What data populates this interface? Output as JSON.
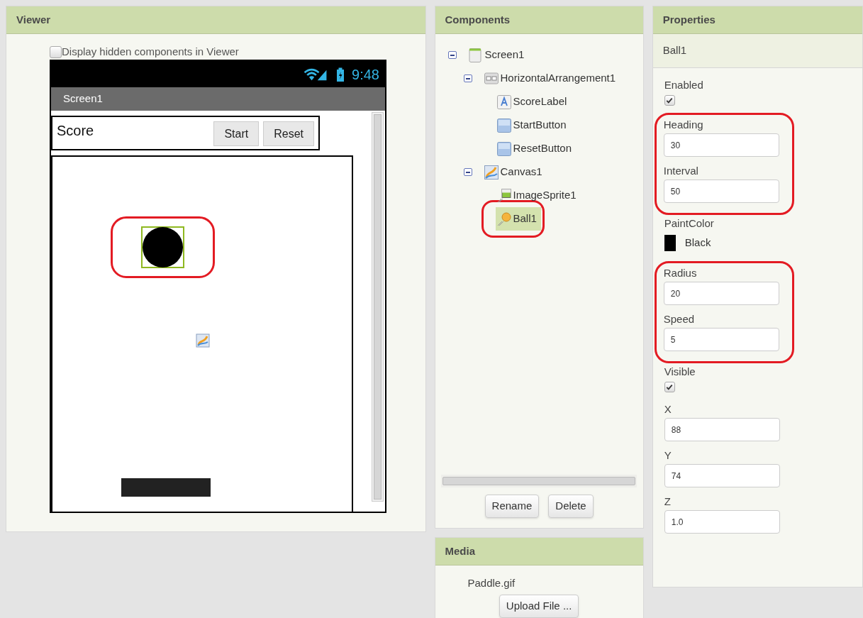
{
  "viewer": {
    "title": "Viewer",
    "display_hidden": {
      "label": "Display hidden components in Viewer",
      "checked": false
    },
    "phone": {
      "time": "9:48",
      "screen_title": "Screen1",
      "score_label": "Score",
      "buttons": [
        "Start",
        "Reset"
      ],
      "sprites": [
        {
          "kind": "ball",
          "selected": true,
          "highlighted": true
        },
        {
          "kind": "paddle",
          "selected": false
        }
      ]
    }
  },
  "components": {
    "title": "Components",
    "tree": [
      {
        "label": "Screen1",
        "kind": "screen",
        "expanded": true,
        "selected": false,
        "children": [
          {
            "label": "HorizontalArrangement1",
            "kind": "arrangement",
            "expanded": true,
            "selected": false,
            "children": [
              {
                "label": "ScoreLabel",
                "kind": "label",
                "selected": false
              },
              {
                "label": "StartButton",
                "kind": "button",
                "selected": false
              },
              {
                "label": "ResetButton",
                "kind": "button",
                "selected": false
              }
            ]
          },
          {
            "label": "Canvas1",
            "kind": "canvas",
            "expanded": true,
            "selected": false,
            "children": [
              {
                "label": "ImageSprite1",
                "kind": "sprite",
                "selected": false
              },
              {
                "label": "Ball1",
                "kind": "ball",
                "selected": true,
                "highlighted": true
              }
            ]
          }
        ]
      }
    ],
    "buttons": [
      "Rename",
      "Delete"
    ]
  },
  "media": {
    "title": "Media",
    "files": [
      "Paddle.gif"
    ],
    "upload_button": "Upload File ..."
  },
  "properties": {
    "title": "Properties",
    "component": "Ball1",
    "items": [
      {
        "kind": "checkbox",
        "label": "Enabled",
        "checked": true
      },
      {
        "kind": "number",
        "label": "Heading",
        "value": "30",
        "highlighted": true
      },
      {
        "kind": "number",
        "label": "Interval",
        "value": "50",
        "highlighted": true
      },
      {
        "kind": "color",
        "label": "PaintColor",
        "value": "Black",
        "color": "#000000"
      },
      {
        "kind": "number",
        "label": "Radius",
        "value": "20",
        "highlighted": true
      },
      {
        "kind": "number",
        "label": "Speed",
        "value": "5",
        "highlighted": true
      },
      {
        "kind": "checkbox",
        "label": "Visible",
        "checked": true
      },
      {
        "kind": "number",
        "label": "X",
        "value": "88"
      },
      {
        "kind": "number",
        "label": "Y",
        "value": "74"
      },
      {
        "kind": "number",
        "label": "Z",
        "value": "1.0"
      }
    ]
  }
}
